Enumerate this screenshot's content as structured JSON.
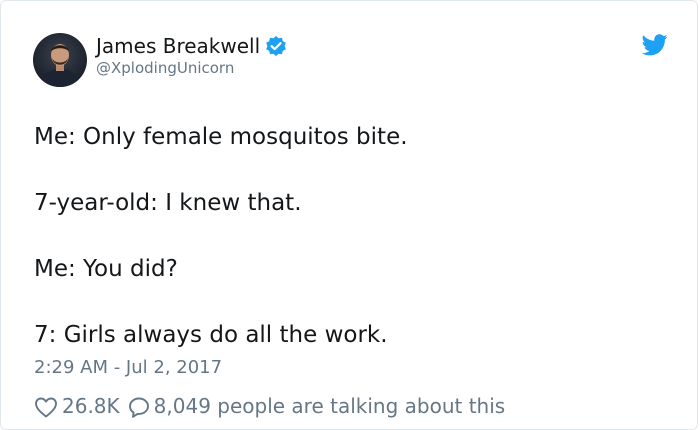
{
  "tweet": {
    "author": {
      "display_name": "James Breakwell",
      "handle": "@XplodingUnicorn",
      "verified": true,
      "avatar_icon": "profile-photo"
    },
    "brand_icon": "twitter-bird-icon",
    "text_lines": [
      "Me: Only female mosquitos bite.",
      "7-year-old: I knew that.",
      "Me: You did?",
      "7: Girls always do all the work."
    ],
    "timestamp": "2:29 AM - Jul 2, 2017",
    "stats": {
      "likes": "26.8K",
      "talking": "8,049 people are talking about this"
    }
  },
  "colors": {
    "text": "#14171a",
    "secondary": "#657786",
    "brand": "#1da1f2",
    "border": "#e1e8ed"
  }
}
